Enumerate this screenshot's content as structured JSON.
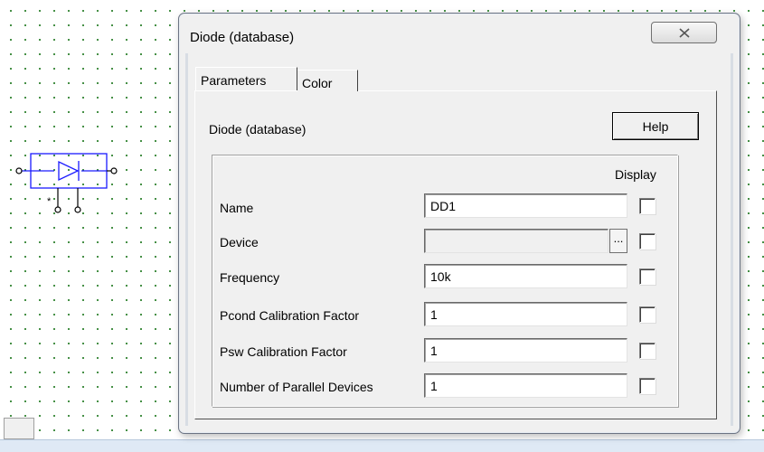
{
  "dialog": {
    "title": "Diode (database)",
    "close_icon": "close-icon"
  },
  "tabs": [
    {
      "label": "Parameters",
      "active": true
    },
    {
      "label": "Color",
      "active": false
    }
  ],
  "panel": {
    "title": "Diode (database)",
    "help_label": "Help",
    "display_header": "Display"
  },
  "params": [
    {
      "label": "Name",
      "value": "DD1",
      "display": false
    },
    {
      "label": "Device",
      "value": "",
      "display": false,
      "browse_label": "..."
    },
    {
      "label": "Frequency",
      "value": "10k",
      "display": false
    },
    {
      "label": "Pcond Calibration Factor",
      "value": "1",
      "display": false
    },
    {
      "label": "Psw Calibration Factor",
      "value": "1",
      "display": false
    },
    {
      "label": "Number of Parallel Devices",
      "value": "1",
      "display": false
    }
  ],
  "schematic": {
    "component": "diode-symbol-icon",
    "pin_marker": "*"
  },
  "colors": {
    "grid_dot": "#2a7f2a",
    "component": "#1a1aff",
    "dialog_bg": "#f0f0f0"
  }
}
